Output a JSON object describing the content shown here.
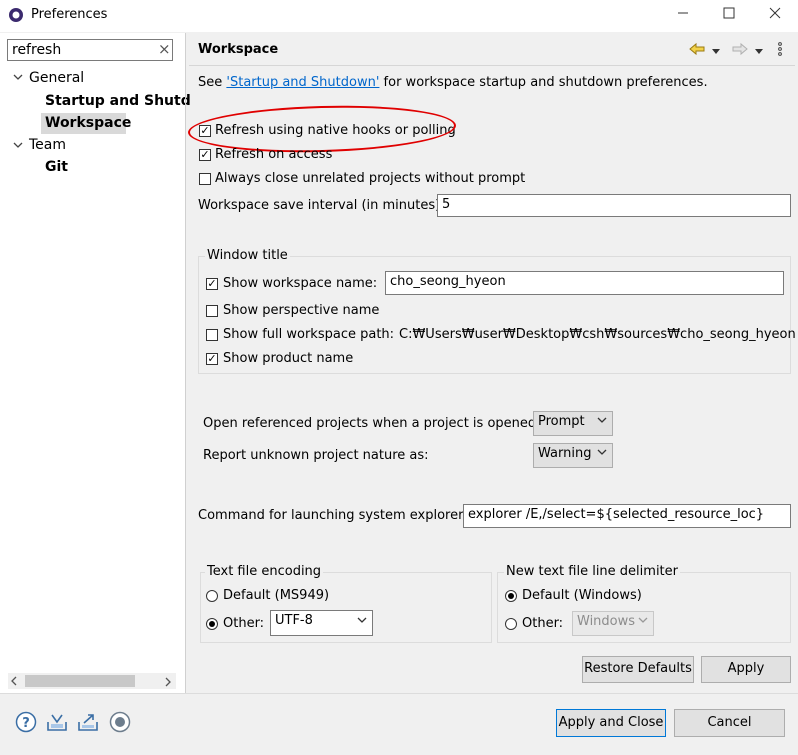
{
  "window": {
    "title": "Preferences",
    "min_icon": "minimize-icon",
    "max_icon": "maximize-icon",
    "close_icon": "close-icon"
  },
  "filter": {
    "value": "refresh",
    "clear_glyph": "×"
  },
  "tree": {
    "general": "General",
    "startup": "Startup and Shutd",
    "workspace": "Workspace",
    "team": "Team",
    "git": "Git"
  },
  "page": {
    "title": "Workspace",
    "see_prefix": "See ",
    "see_link": "'Startup and Shutdown'",
    "see_suffix": " for workspace startup and shutdown preferences.",
    "refresh_native": "Refresh using native hooks or polling",
    "refresh_access": "Refresh on access",
    "always_close": "Always close unrelated projects without prompt",
    "save_interval_label": "Workspace save interval (in minutes):",
    "save_interval_value": "5",
    "window_title_group": "Window title",
    "show_ws_name": "Show workspace name:",
    "ws_name_value": "cho_seong_hyeon",
    "show_perspective": "Show perspective name",
    "show_full_path": "Show full workspace path:",
    "full_path_value": "C:₩Users₩user₩Desktop₩csh₩sources₩cho_seong_hyeon",
    "show_product": "Show product name",
    "open_ref_label": "Open referenced projects when a project is opened:",
    "open_ref_value": "Prompt",
    "report_label": "Report unknown project nature as:",
    "report_value": "Warning",
    "command_label": "Command for launching system explorer:",
    "command_value": "explorer /E,/select=${selected_resource_loc}",
    "encoding_group": "Text file encoding",
    "enc_default": "Default (MS949)",
    "enc_other": "Other:",
    "enc_other_value": "UTF-8",
    "delim_group": "New text file line delimiter",
    "delim_default": "Default (Windows)",
    "delim_other": "Other:",
    "delim_other_value": "Windows",
    "restore_defaults": "Restore Defaults",
    "apply": "Apply"
  },
  "footer": {
    "apply_close": "Apply and Close",
    "cancel": "Cancel"
  },
  "state": {
    "refresh_native": true,
    "refresh_access": true,
    "always_close": false,
    "show_ws_name": true,
    "show_perspective": false,
    "show_full_path": false,
    "show_product": true,
    "enc_default": false,
    "enc_other": true,
    "delim_default": true,
    "delim_other": false
  },
  "colors": {
    "accent_ellipse": "#e00000",
    "link": "#0066cc",
    "selection": "#cce4f7"
  }
}
